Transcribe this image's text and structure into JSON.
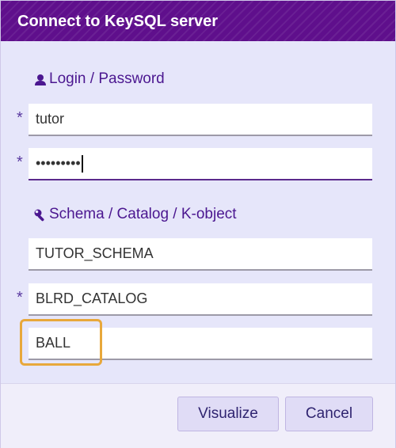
{
  "dialog": {
    "title": "Connect to KeySQL server"
  },
  "login_section": {
    "heading": "Login / Password",
    "icon": "user-icon",
    "login": {
      "value": "tutor",
      "required_mark": "*"
    },
    "password": {
      "masked_value": "•••••••••",
      "required_mark": "*"
    }
  },
  "schema_section": {
    "heading": "Schema / Catalog / K-object",
    "icon": "wrench-icon",
    "schema": {
      "value": "TUTOR_SCHEMA"
    },
    "catalog": {
      "value": "BLRD_CATALOG",
      "required_mark": "*"
    },
    "kobject": {
      "value": "BALL"
    }
  },
  "buttons": {
    "visualize": "Visualize",
    "cancel": "Cancel"
  },
  "colors": {
    "title_bar": "#5f0f8c",
    "accent": "#4b1790",
    "highlight": "#e8a83b"
  }
}
